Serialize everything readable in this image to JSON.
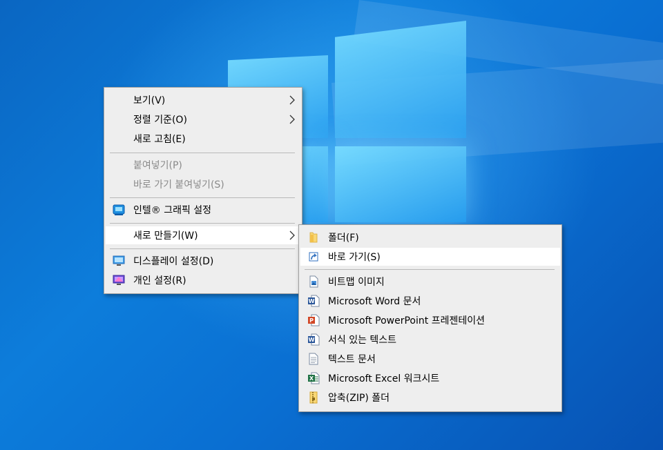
{
  "main_menu": {
    "items": [
      {
        "label": "보기(V)",
        "has_submenu": true,
        "disabled": false
      },
      {
        "label": "정렬 기준(O)",
        "has_submenu": true,
        "disabled": false
      },
      {
        "label": "새로 고침(E)",
        "has_submenu": false,
        "disabled": false
      },
      {
        "label": "붙여넣기(P)",
        "has_submenu": false,
        "disabled": true
      },
      {
        "label": "바로 가기 붙여넣기(S)",
        "has_submenu": false,
        "disabled": true
      },
      {
        "label": "인텔® 그래픽 설정",
        "icon": "intel-graphics-icon",
        "has_submenu": false,
        "disabled": false
      },
      {
        "label": "새로 만들기(W)",
        "has_submenu": true,
        "disabled": false,
        "highlighted": true
      },
      {
        "label": "디스플레이 설정(D)",
        "icon": "display-icon",
        "has_submenu": false,
        "disabled": false
      },
      {
        "label": "개인 설정(R)",
        "icon": "personalize-icon",
        "has_submenu": false,
        "disabled": false
      }
    ]
  },
  "new_submenu": {
    "items": [
      {
        "label": "폴더(F)",
        "icon": "folder-icon"
      },
      {
        "label": "바로 가기(S)",
        "icon": "shortcut-icon",
        "highlighted": true
      },
      {
        "label": "비트맵 이미지",
        "icon": "bitmap-icon"
      },
      {
        "label": "Microsoft Word 문서",
        "icon": "word-icon"
      },
      {
        "label": "Microsoft PowerPoint 프레젠테이션",
        "icon": "powerpoint-icon"
      },
      {
        "label": "서식 있는 텍스트",
        "icon": "rtf-icon"
      },
      {
        "label": "텍스트 문서",
        "icon": "text-document-icon"
      },
      {
        "label": "Microsoft Excel 워크시트",
        "icon": "excel-icon"
      },
      {
        "label": "압축(ZIP) 폴더",
        "icon": "zip-folder-icon"
      }
    ]
  },
  "colors": {
    "menu_bg": "#eeeeee",
    "highlight_bg": "#ffffff",
    "disabled_text": "#8a8a8a",
    "desktop_blue": "#0a6fd2",
    "word_blue": "#2b579a",
    "powerpoint_red": "#d24726",
    "excel_green": "#217346",
    "folder_yellow": "#f8d775"
  }
}
